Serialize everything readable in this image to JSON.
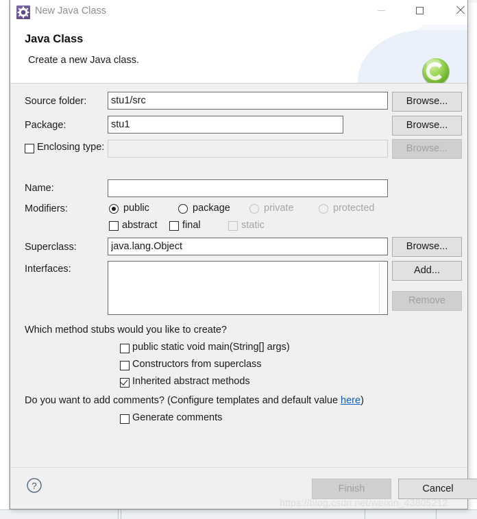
{
  "window": {
    "title": "New Java Class",
    "icon": "gear-icon",
    "minimize_label": "Minimize",
    "maximize_label": "Maximize",
    "close_label": "Close"
  },
  "banner": {
    "title": "Java Class",
    "description": "Create a new Java class.",
    "badge_letter": "C",
    "badge_color": "#7cc241"
  },
  "form": {
    "source_folder": {
      "label": "Source folder:",
      "value": "stu1/src",
      "browse_label": "Browse..."
    },
    "package": {
      "label": "Package:",
      "value": "stu1",
      "browse_label": "Browse..."
    },
    "enclosing_type": {
      "label": "Enclosing type:",
      "value": "",
      "checked": false,
      "enabled": false,
      "browse_label": "Browse..."
    },
    "name": {
      "label": "Name:",
      "value": ""
    },
    "modifiers": {
      "label": "Modifiers:",
      "radios": [
        {
          "label": "public",
          "selected": true,
          "enabled": true
        },
        {
          "label": "package",
          "selected": false,
          "enabled": true
        },
        {
          "label": "private",
          "selected": false,
          "enabled": false
        },
        {
          "label": "protected",
          "selected": false,
          "enabled": false
        }
      ],
      "checkboxes": [
        {
          "label": "abstract",
          "checked": false,
          "enabled": true
        },
        {
          "label": "final",
          "checked": false,
          "enabled": true
        },
        {
          "label": "static",
          "checked": false,
          "enabled": false
        }
      ]
    },
    "superclass": {
      "label": "Superclass:",
      "value": "java.lang.Object",
      "browse_label": "Browse..."
    },
    "interfaces": {
      "label": "Interfaces:",
      "items": [],
      "add_label": "Add...",
      "remove_label": "Remove"
    }
  },
  "stubs": {
    "question": "Which method stubs would you like to create?",
    "options": [
      {
        "label": "public static void main(String[] args)",
        "checked": false
      },
      {
        "label": "Constructors from superclass",
        "checked": false
      },
      {
        "label": "Inherited abstract methods",
        "checked": true
      }
    ]
  },
  "comments": {
    "question_prefix": "Do you want to add comments? (Configure templates and default value ",
    "link_text": "here",
    "question_suffix": ")",
    "generate_label": "Generate comments",
    "generate_checked": false
  },
  "footer": {
    "help_label": "?",
    "finish_label": "Finish",
    "finish_enabled": false,
    "cancel_label": "Cancel",
    "cancel_enabled": true
  },
  "watermark": {
    "text": "https://blog.csdn.net/weixin_43805212"
  }
}
